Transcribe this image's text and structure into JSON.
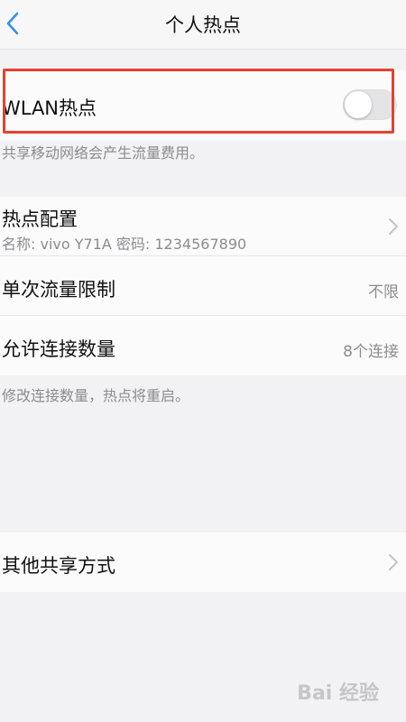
{
  "header": {
    "title": "个人热点"
  },
  "wlan_hotspot": {
    "label": "WLAN热点",
    "enabled": false,
    "note": "共享移动网络会产生流量费用。"
  },
  "hotspot_config": {
    "label": "热点配置",
    "detail": "名称: vivo Y71A  密码: 1234567890"
  },
  "data_limit": {
    "label": "单次流量限制",
    "value": "不限"
  },
  "connections": {
    "label": "允许连接数量",
    "value": "8个连接",
    "note": "修改连接数量，热点将重启。"
  },
  "other_sharing": {
    "label": "其他共享方式"
  },
  "watermark": {
    "text": "Bai 经验"
  },
  "colors": {
    "highlight": "#e8402f",
    "accent": "#2f8ff0"
  }
}
